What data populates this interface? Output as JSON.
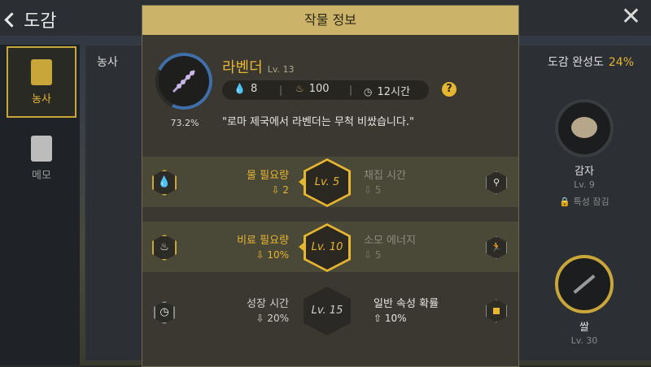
{
  "header": {
    "back_label": "도감"
  },
  "sidebar": {
    "items": [
      {
        "label": "농사"
      },
      {
        "label": "메모"
      }
    ]
  },
  "left_panel": {
    "title": "농사"
  },
  "right_panel": {
    "completion_label": "도감 완성도",
    "completion_value": "24%",
    "crops": [
      {
        "name": "감자",
        "level": "Lv. 9",
        "lock_text": "특성 잠김"
      },
      {
        "name": "쌀",
        "level": "Lv. 30"
      }
    ]
  },
  "modal": {
    "title": "작물 정보",
    "crop": {
      "name": "라벤더",
      "level": "Lv. 13",
      "progress_text": "73.2%",
      "water": "8",
      "fertilizer": "100",
      "grow_time": "12시간",
      "help": "?",
      "quote": "\"로마 제국에서 라벤더는 무척 비쌌습니다.\""
    },
    "rows": [
      {
        "label": "물 필요량",
        "sub": "2",
        "level": "Lv. 5",
        "right_label": "채집 시간",
        "right_sub": "5"
      },
      {
        "label": "비료 필요량",
        "sub": "10%",
        "level": "Lv. 10",
        "right_label": "소모 에너지",
        "right_sub": "5"
      },
      {
        "label": "성장 시간",
        "sub": "20%",
        "level": "Lv. 15",
        "right_label": "일반 속성 확률",
        "right_sub": "10%"
      }
    ]
  },
  "colors": {
    "accent": "#e6b531",
    "title_bar": "#cbb46a",
    "progress_arc": "#3f6ea8"
  },
  "icons": {
    "water": "water-drop-icon",
    "fertilizer": "fertilizer-icon",
    "clock": "clock-icon",
    "harvest": "harvest-tool-icon",
    "energy": "running-person-icon",
    "attribute": "square-attribute-icon"
  }
}
